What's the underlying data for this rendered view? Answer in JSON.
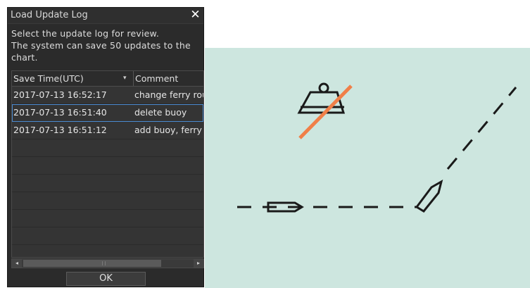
{
  "dialog": {
    "title": "Load Update Log",
    "close_symbol": "✕",
    "description": [
      "Select the update log for review.",
      "The system can save 50 updates to the",
      "chart."
    ],
    "columns": {
      "save_time": "Save Time(UTC)",
      "comment": "Comment"
    },
    "sort_symbol": "▾",
    "rows": [
      {
        "save_time": "2017-07-13 16:52:17",
        "comment": "change ferry route"
      },
      {
        "save_time": "2017-07-13 16:51:40",
        "comment": "delete buoy"
      },
      {
        "save_time": "2017-07-13 16:51:12",
        "comment": "add buoy, ferry"
      }
    ],
    "selected_row": 1,
    "scroll": {
      "left_symbol": "◂",
      "right_symbol": "▸"
    },
    "ok_label": "OK"
  },
  "chart": {
    "background_color": "#cde6df",
    "strike_color": "#f07f48",
    "symbols": [
      "buoy-icon",
      "ferry-route-line",
      "vessel-icon"
    ]
  }
}
